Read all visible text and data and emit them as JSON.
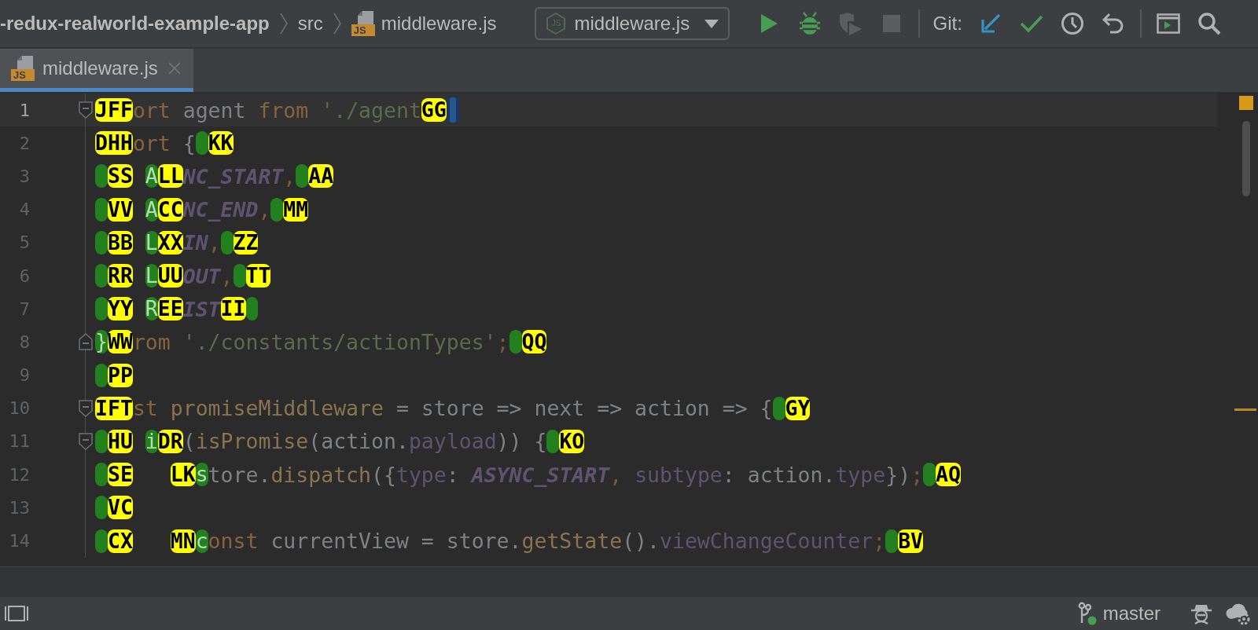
{
  "breadcrumbs": [
    {
      "kind": "project",
      "text": "-redux-realworld-example-app"
    },
    {
      "kind": "folder",
      "text": "src"
    },
    {
      "kind": "js-file",
      "text": "middleware.js",
      "icon_text": "JS"
    }
  ],
  "run_config": {
    "label": "middleware.js",
    "icon_text": "JS"
  },
  "toolbar": {
    "run_actions": [
      {
        "kind": "run",
        "disabled": false
      },
      {
        "kind": "debug",
        "disabled": false
      },
      {
        "kind": "coverage",
        "disabled": true
      },
      {
        "kind": "stop",
        "disabled": true
      }
    ],
    "git_label": "Git:",
    "git_actions": [
      {
        "kind": "update"
      },
      {
        "kind": "commit"
      },
      {
        "kind": "history"
      },
      {
        "kind": "rollback"
      }
    ],
    "tools": [
      {
        "kind": "terminal"
      },
      {
        "kind": "search"
      }
    ]
  },
  "tabs": [
    {
      "label": "middleware.js",
      "icon_text": "JS",
      "selected": true
    }
  ],
  "editor": {
    "lines": [
      {
        "number": "1",
        "current": true,
        "fold": {
          "kind": "start"
        },
        "segments": [
          {
            "kind": "label",
            "text": "JFF"
          },
          {
            "kind": "keyword",
            "text": "ort"
          },
          {
            "kind": "plain",
            "text": " agent "
          },
          {
            "kind": "keyword",
            "text": "from"
          },
          {
            "kind": "string",
            "text": " './agent"
          },
          {
            "kind": "label",
            "text": "GG"
          },
          {
            "kind": "cursor"
          }
        ]
      },
      {
        "number": "2",
        "current": false,
        "segments": [
          {
            "kind": "label",
            "text": "DHH"
          },
          {
            "kind": "keyword",
            "text": "ort"
          },
          {
            "kind": "plain",
            "text": " {"
          },
          {
            "kind": "marker"
          },
          {
            "kind": "label",
            "text": "KK"
          }
        ]
      },
      {
        "number": "3",
        "current": false,
        "segments": [
          {
            "kind": "marker"
          },
          {
            "kind": "label",
            "text": "SS"
          },
          {
            "kind": "space"
          },
          {
            "kind": "marker",
            "text": "A"
          },
          {
            "kind": "label",
            "text": "LL"
          },
          {
            "kind": "constant",
            "text": "NC_START"
          },
          {
            "kind": "punct",
            "text": ","
          },
          {
            "kind": "marker"
          },
          {
            "kind": "label",
            "text": "AA"
          }
        ]
      },
      {
        "number": "4",
        "current": false,
        "segments": [
          {
            "kind": "marker"
          },
          {
            "kind": "label",
            "text": "VV"
          },
          {
            "kind": "space"
          },
          {
            "kind": "marker",
            "text": "A"
          },
          {
            "kind": "label",
            "text": "CC"
          },
          {
            "kind": "constant",
            "text": "NC_END"
          },
          {
            "kind": "punct",
            "text": ","
          },
          {
            "kind": "marker"
          },
          {
            "kind": "label",
            "text": "MM"
          }
        ]
      },
      {
        "number": "5",
        "current": false,
        "segments": [
          {
            "kind": "marker"
          },
          {
            "kind": "label",
            "text": "BB"
          },
          {
            "kind": "space"
          },
          {
            "kind": "marker",
            "text": "L"
          },
          {
            "kind": "label",
            "text": "XX"
          },
          {
            "kind": "constant",
            "text": "IN"
          },
          {
            "kind": "punct",
            "text": ","
          },
          {
            "kind": "marker"
          },
          {
            "kind": "label",
            "text": "ZZ"
          }
        ]
      },
      {
        "number": "6",
        "current": false,
        "segments": [
          {
            "kind": "marker"
          },
          {
            "kind": "label",
            "text": "RR"
          },
          {
            "kind": "space"
          },
          {
            "kind": "marker",
            "text": "L"
          },
          {
            "kind": "label",
            "text": "UU"
          },
          {
            "kind": "constant",
            "text": "OUT"
          },
          {
            "kind": "punct",
            "text": ","
          },
          {
            "kind": "marker"
          },
          {
            "kind": "label",
            "text": "TT"
          }
        ]
      },
      {
        "number": "7",
        "current": false,
        "segments": [
          {
            "kind": "marker"
          },
          {
            "kind": "label",
            "text": "YY"
          },
          {
            "kind": "space"
          },
          {
            "kind": "marker",
            "text": "R"
          },
          {
            "kind": "label",
            "text": "EE"
          },
          {
            "kind": "constant",
            "text": "IST"
          },
          {
            "kind": "label",
            "text": "II"
          },
          {
            "kind": "marker"
          }
        ]
      },
      {
        "number": "8",
        "current": false,
        "fold": {
          "kind": "end"
        },
        "segments": [
          {
            "kind": "marker",
            "text": "}"
          },
          {
            "kind": "label",
            "text": "WW"
          },
          {
            "kind": "keyword",
            "text": "rom"
          },
          {
            "kind": "string",
            "text": " './constants/actionTypes'"
          },
          {
            "kind": "punct",
            "text": ";"
          },
          {
            "kind": "marker"
          },
          {
            "kind": "label",
            "text": "QQ"
          }
        ]
      },
      {
        "number": "9",
        "current": false,
        "segments": [
          {
            "kind": "marker"
          },
          {
            "kind": "label",
            "text": "PP"
          }
        ]
      },
      {
        "number": "10",
        "current": false,
        "fold": {
          "kind": "start"
        },
        "segments": [
          {
            "kind": "label",
            "text": "IFT"
          },
          {
            "kind": "keyword",
            "text": "st"
          },
          {
            "kind": "function",
            "text": " promiseMiddleware"
          },
          {
            "kind": "plain",
            "text": " = store => next => action => {"
          },
          {
            "kind": "marker"
          },
          {
            "kind": "label",
            "text": "GY"
          }
        ]
      },
      {
        "number": "11",
        "current": false,
        "fold": {
          "kind": "start"
        },
        "segments": [
          {
            "kind": "marker"
          },
          {
            "kind": "label",
            "text": "HU"
          },
          {
            "kind": "space"
          },
          {
            "kind": "marker",
            "text": "i"
          },
          {
            "kind": "label",
            "text": "DR"
          },
          {
            "kind": "plain",
            "text": "("
          },
          {
            "kind": "function",
            "text": "isPromise"
          },
          {
            "kind": "plain",
            "text": "(action."
          },
          {
            "kind": "property",
            "text": "payload"
          },
          {
            "kind": "plain",
            "text": ")) {"
          },
          {
            "kind": "marker"
          },
          {
            "kind": "label",
            "text": "KO"
          }
        ]
      },
      {
        "number": "12",
        "current": false,
        "segments": [
          {
            "kind": "marker"
          },
          {
            "kind": "label",
            "text": "SE"
          },
          {
            "kind": "space"
          },
          {
            "kind": "space"
          },
          {
            "kind": "space"
          },
          {
            "kind": "label",
            "text": "LK"
          },
          {
            "kind": "marker",
            "text": "s"
          },
          {
            "kind": "plain",
            "text": "tore."
          },
          {
            "kind": "function",
            "text": "dispatch"
          },
          {
            "kind": "plain",
            "text": "({"
          },
          {
            "kind": "property",
            "text": "type"
          },
          {
            "kind": "plain",
            "text": ": "
          },
          {
            "kind": "constant",
            "text": "ASYNC_START"
          },
          {
            "kind": "punct",
            "text": ","
          },
          {
            "kind": "property",
            "text": " subtype"
          },
          {
            "kind": "plain",
            "text": ": action."
          },
          {
            "kind": "property",
            "text": "type"
          },
          {
            "kind": "plain",
            "text": "})"
          },
          {
            "kind": "punct",
            "text": ";"
          },
          {
            "kind": "marker"
          },
          {
            "kind": "label",
            "text": "AQ"
          }
        ]
      },
      {
        "number": "13",
        "current": false,
        "segments": [
          {
            "kind": "marker"
          },
          {
            "kind": "label",
            "text": "VC"
          }
        ]
      },
      {
        "number": "14",
        "current": false,
        "segments": [
          {
            "kind": "marker"
          },
          {
            "kind": "label",
            "text": "CX"
          },
          {
            "kind": "space"
          },
          {
            "kind": "space"
          },
          {
            "kind": "space"
          },
          {
            "kind": "label",
            "text": "MN"
          },
          {
            "kind": "marker",
            "text": "c"
          },
          {
            "kind": "keyword",
            "text": "onst"
          },
          {
            "kind": "plain",
            "text": " currentView = store."
          },
          {
            "kind": "function",
            "text": "getState"
          },
          {
            "kind": "plain",
            "text": "()."
          },
          {
            "kind": "property",
            "text": "viewChangeCounter"
          },
          {
            "kind": "punct",
            "text": ";"
          },
          {
            "kind": "marker"
          },
          {
            "kind": "label",
            "text": "BV"
          }
        ]
      }
    ]
  },
  "status_bar": {
    "branch": "master"
  }
}
